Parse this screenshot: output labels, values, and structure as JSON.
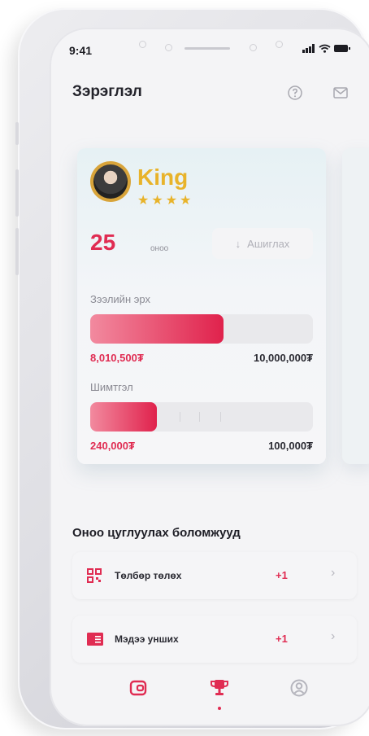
{
  "status_bar": {
    "time": "9:41"
  },
  "header": {
    "title": "Зэрэглэл"
  },
  "level_card": {
    "rank": "King",
    "stars": "★★★★",
    "stars_count": 4,
    "points": "25",
    "points_unit": "оноо",
    "use_button": "Ашиглах",
    "credit": {
      "label": "Зээлийн эрх",
      "used": "8,010,500₮",
      "limit": "10,000,000₮",
      "fraction": 0.6
    },
    "reward": {
      "label": "Шимтгэл",
      "earned": "240,000₮",
      "target": "100,000₮",
      "fraction": 0.3
    }
  },
  "opportunities": {
    "title": "Оноо цуглуулах боломжууд",
    "items": [
      {
        "label": "Төлбөр төлөх",
        "points": "+1",
        "icon": "qr-code-icon"
      },
      {
        "label": "Мэдээ унших",
        "points": "+1",
        "icon": "news-icon"
      }
    ]
  },
  "tab_bar": {
    "active": "trophy",
    "tabs": [
      "wallet-icon",
      "trophy-icon",
      "profile-icon"
    ]
  },
  "colors": {
    "accent": "#e02c52",
    "gold": "#e8b32a"
  }
}
